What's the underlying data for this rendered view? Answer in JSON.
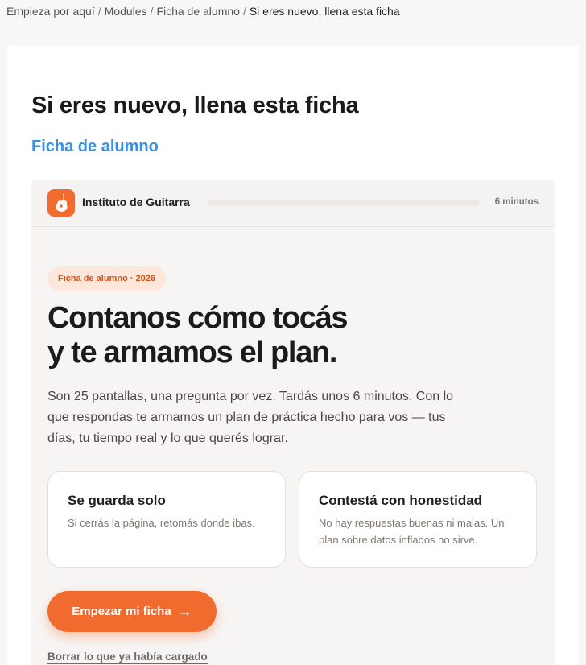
{
  "breadcrumb": {
    "items": [
      "Empieza por aquí",
      "Modules",
      "Ficha de alumno"
    ],
    "current": "Si eres nuevo, llena esta ficha",
    "separator": "/"
  },
  "page": {
    "title": "Si eres nuevo, llena esta ficha",
    "subtitle": "Ficha de alumno"
  },
  "embed": {
    "brand": "Instituto de Guitarra",
    "logo_icon": "guitar-icon",
    "progress": 0,
    "duration": "6 minutos",
    "tag": "Ficha de alumno · 2026",
    "hero_line1": "Contanos cómo tocás",
    "hero_line2": "y te armamos el plan.",
    "intro": "Son 25 pantallas, una pregunta por vez. Tardás unos 6 minutos. Con lo que respondas te armamos un plan de práctica hecho para vos — tus días, tu tiempo real y lo que querés lograr.",
    "features": [
      {
        "title": "Se guarda solo",
        "text": "Si cerrás la página, retomás donde ibas."
      },
      {
        "title": "Contestá con honestidad",
        "text": "No hay respuestas buenas ni malas. Un plan sobre datos inflados no sirve."
      }
    ],
    "cta_label": "Empezar mi ficha",
    "cta_arrow": "→",
    "reset_label": "Borrar lo que ya había cargado"
  },
  "colors": {
    "accent": "#f26b2e",
    "link_blue": "#3b8fe0",
    "tag_bg": "#fde7da"
  }
}
